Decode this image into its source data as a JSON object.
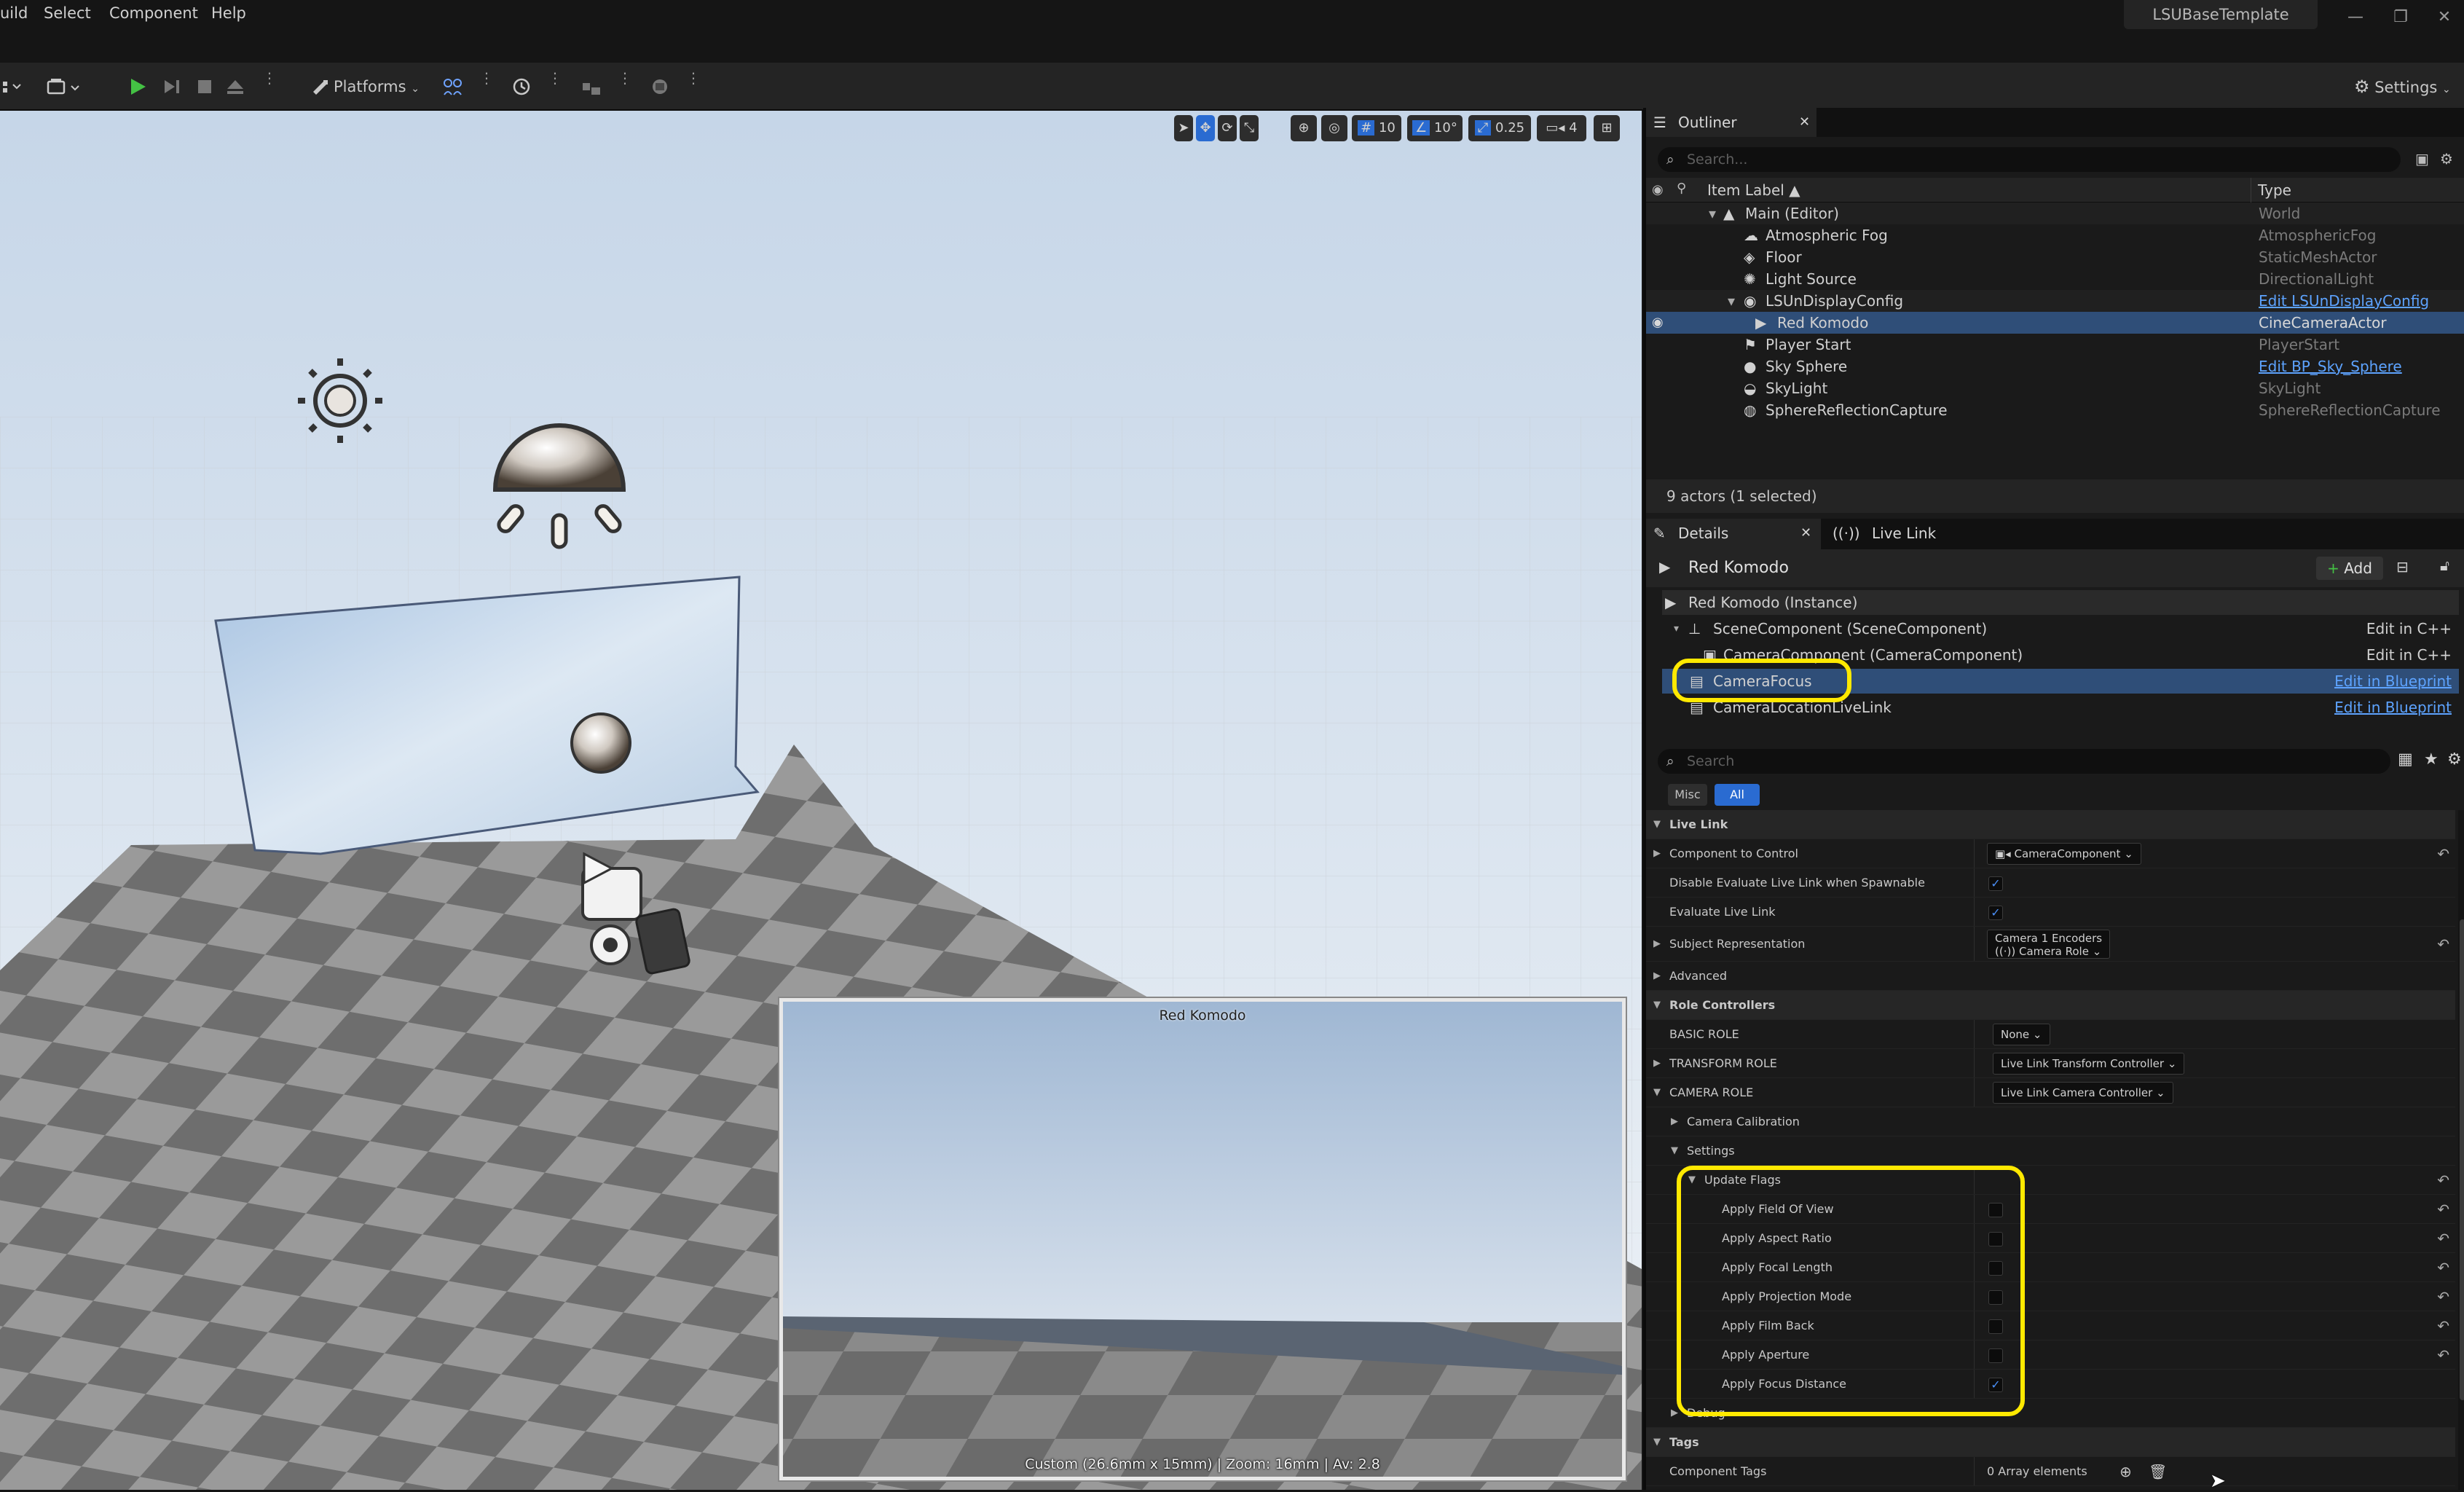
{
  "menu": {
    "items": [
      "uild",
      "Select",
      "Component",
      "Help"
    ]
  },
  "project_tab": "LSUBaseTemplate",
  "window": {
    "minimize": "—",
    "restore": "❐",
    "close": "✕"
  },
  "toolbar": {
    "platforms_label": "Platforms",
    "settings_label": "Settings"
  },
  "viewport_toolbar": {
    "grid_snap": "10",
    "rotation_snap": "10°",
    "scale_snap": "0.25",
    "camera_speed": "4"
  },
  "pip": {
    "title": "Red Komodo",
    "info": "Custom (26.6mm x 15mm) | Zoom: 16mm | Av: 2.8"
  },
  "outliner": {
    "tab_label": "Outliner",
    "search_placeholder": "Search...",
    "col_label": "Item Label ▲",
    "col_type": "Type",
    "rows": [
      {
        "label": "Main (Editor)",
        "type": "World"
      },
      {
        "label": "Atmospheric Fog",
        "type": "AtmosphericFog"
      },
      {
        "label": "Floor",
        "type": "StaticMeshActor"
      },
      {
        "label": "Light Source",
        "type": "DirectionalLight"
      },
      {
        "label": "LSUnDisplayConfig",
        "type": "Edit LSUnDisplayConfig"
      },
      {
        "label": "Red Komodo",
        "type": "CineCameraActor"
      },
      {
        "label": "Player Start",
        "type": "PlayerStart"
      },
      {
        "label": "Sky Sphere",
        "type": "Edit BP_Sky_Sphere"
      },
      {
        "label": "SkyLight",
        "type": "SkyLight"
      },
      {
        "label": "SphereReflectionCapture",
        "type": "SphereReflectionCapture"
      }
    ],
    "status": "9 actors (1 selected)"
  },
  "details": {
    "tab_label": "Details",
    "livelink_tab": "Live Link",
    "actor_name": "Red Komodo",
    "add_label": "Add",
    "instance_label": "Red Komodo (Instance)",
    "components": [
      {
        "label": "SceneComponent (SceneComponent)",
        "action": "Edit in C++"
      },
      {
        "label": "CameraComponent (CameraComponent)",
        "action": "Edit in C++"
      },
      {
        "label": "CameraFocus",
        "action": "Edit in Blueprint"
      },
      {
        "label": "CameraLocationLiveLink",
        "action": "Edit in Blueprint"
      }
    ],
    "search_placeholder": "Search",
    "filter_misc": "Misc",
    "filter_all": "All",
    "cat_live_link": "Live Link",
    "component_to_control": "Component to Control",
    "component_to_control_value": "CameraComponent",
    "disable_eval": "Disable Evaluate Live Link when Spawnable",
    "evaluate": "Evaluate Live Link",
    "subject_rep": "Subject Representation",
    "subject_rep_value1": "Camera 1 Encoders",
    "subject_rep_value2": "Camera Role",
    "advanced": "Advanced",
    "cat_role_controllers": "Role Controllers",
    "basic_role": "BASIC ROLE",
    "basic_role_value": "None",
    "transform_role": "TRANSFORM ROLE",
    "transform_role_value": "Live Link Transform Controller",
    "camera_role": "CAMERA ROLE",
    "camera_role_value": "Live Link Camera Controller",
    "camera_calibration": "Camera Calibration",
    "settings": "Settings",
    "update_flags": "Update Flags",
    "flags": [
      {
        "label": "Apply Field Of View",
        "checked": false
      },
      {
        "label": "Apply Aspect Ratio",
        "checked": false
      },
      {
        "label": "Apply Focal Length",
        "checked": false
      },
      {
        "label": "Apply Projection Mode",
        "checked": false
      },
      {
        "label": "Apply Film Back",
        "checked": false
      },
      {
        "label": "Apply Aperture",
        "checked": false
      },
      {
        "label": "Apply Focus Distance",
        "checked": true
      }
    ],
    "debug": "Debug",
    "cat_tags": "Tags",
    "component_tags": "Component Tags",
    "component_tags_value": "0 Array elements"
  },
  "colors": {
    "accent": "#2a6bd1",
    "selection": "#2f4e78",
    "highlight": "#ffe900",
    "link": "#5da3ff",
    "play": "#44c144"
  }
}
